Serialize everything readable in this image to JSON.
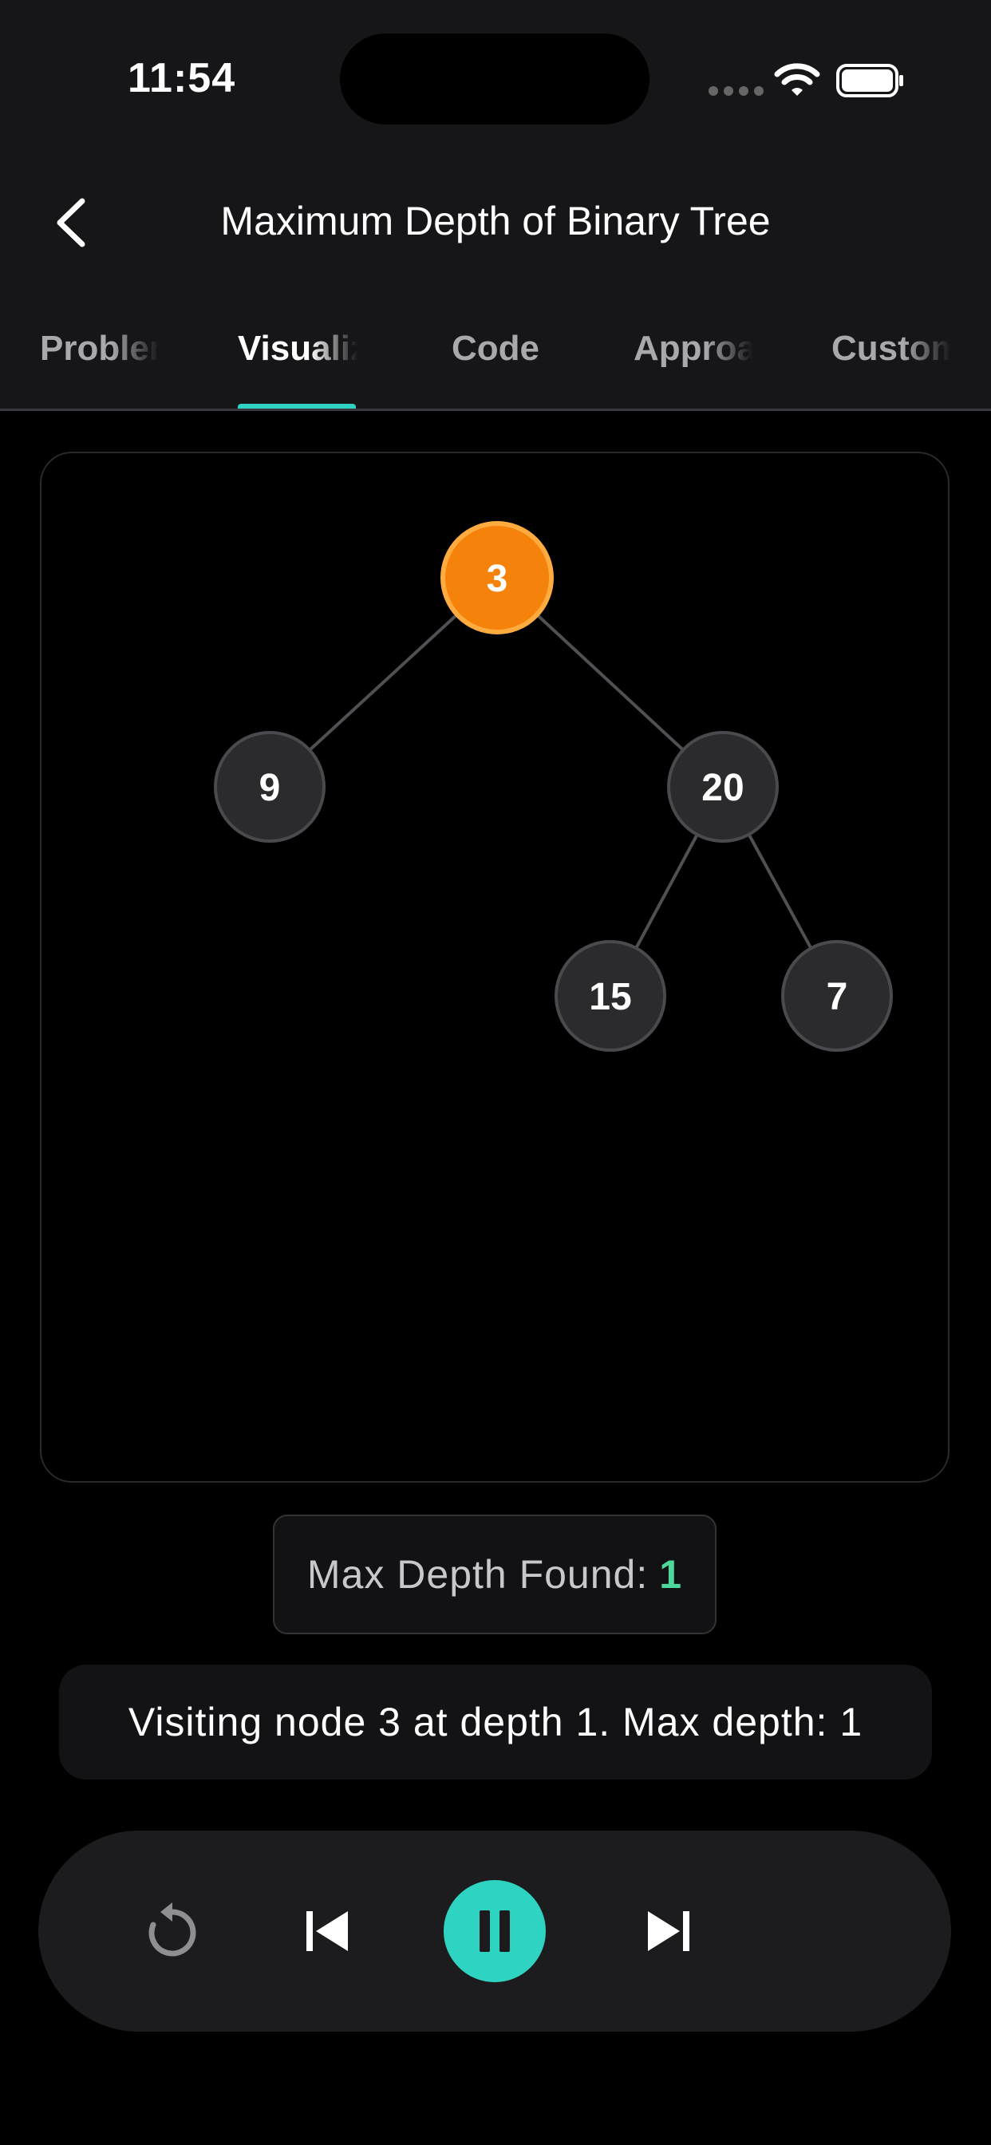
{
  "status_bar": {
    "time": "11:54"
  },
  "header": {
    "title": "Maximum Depth of Binary Tree"
  },
  "tabs": [
    {
      "label": "Problem",
      "active": false
    },
    {
      "label": "Visualize",
      "active": true
    },
    {
      "label": "Code",
      "active": false
    },
    {
      "label": "Approach",
      "active": false
    },
    {
      "label": "Custom",
      "active": false
    }
  ],
  "tree": {
    "nodes": [
      {
        "id": "n3",
        "value": "3",
        "state": "visiting"
      },
      {
        "id": "n9",
        "value": "9",
        "state": "default"
      },
      {
        "id": "n20",
        "value": "20",
        "state": "default"
      },
      {
        "id": "n15",
        "value": "15",
        "state": "default"
      },
      {
        "id": "n7",
        "value": "7",
        "state": "default"
      }
    ],
    "edges": [
      [
        "n3",
        "n9"
      ],
      [
        "n3",
        "n20"
      ],
      [
        "n20",
        "n15"
      ],
      [
        "n20",
        "n7"
      ]
    ]
  },
  "result": {
    "label": "Max Depth Found:",
    "value": "1"
  },
  "step_message": "Visiting node 3 at depth 1. Max depth: 1",
  "colors": {
    "accent": "#2ed3c1",
    "visiting_node": "#f5820a",
    "visiting_border": "#ffab40",
    "node_fill": "#2b2b2e",
    "node_border": "#4a4a4e",
    "depth_value": "#4cd99b"
  },
  "icons": {
    "back": "chevron-left-icon",
    "restart": "restart-icon",
    "previous": "skip-previous-icon",
    "play_pause": "pause-icon",
    "next": "skip-next-icon"
  }
}
